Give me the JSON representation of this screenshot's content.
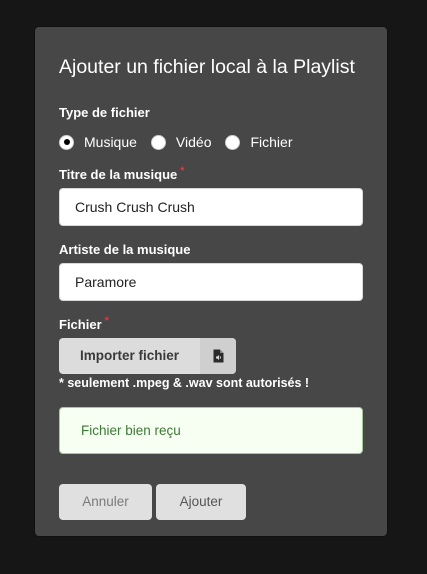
{
  "modal": {
    "title": "Ajouter un fichier local à la Playlist",
    "file_type": {
      "label": "Type de fichier",
      "options": [
        {
          "label": "Musique",
          "checked": true
        },
        {
          "label": "Vidéo",
          "checked": false
        },
        {
          "label": "Fichier",
          "checked": false
        }
      ]
    },
    "title_field": {
      "label": "Titre de la musique",
      "required_mark": "*",
      "value": "Crush Crush Crush"
    },
    "artist_field": {
      "label": "Artiste de la musique",
      "value": "Paramore"
    },
    "file_field": {
      "label": "Fichier",
      "required_mark": "*",
      "button_label": "Importer fichier",
      "icon": "audio-file-icon",
      "hint": "* seulement .mpeg & .wav sont autorisés !"
    },
    "success_message": "Fichier bien reçu",
    "buttons": {
      "cancel": "Annuler",
      "add": "Ajouter"
    }
  },
  "colors": {
    "background": "#161616",
    "modal": "#474747",
    "required": "#e0383e",
    "success_text": "#3d7a37",
    "success_bg": "#f7fef2",
    "success_border": "#a9c89a"
  }
}
